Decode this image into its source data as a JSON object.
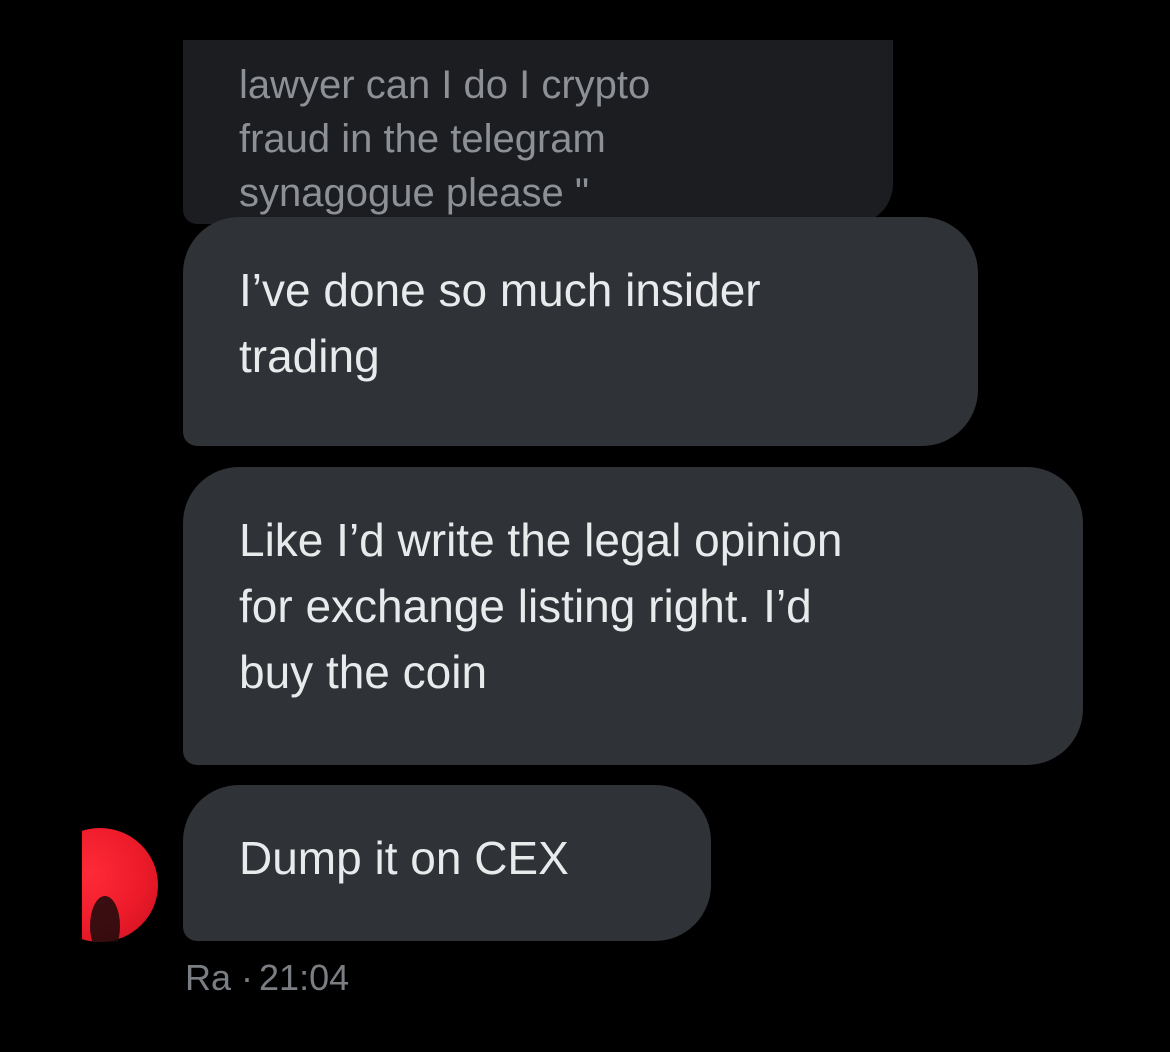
{
  "messages": [
    {
      "text": "lawyer can I do I crypto\nfraud in the telegram\nsynagogue please \"",
      "state": "partially-cropped"
    },
    {
      "text": "I’ve done so much insider\ntrading"
    },
    {
      "text": "Like I’d write the legal opinion\nfor exchange listing right. I’d\nbuy the coin"
    },
    {
      "text": "Dump it on CEX"
    }
  ],
  "meta": {
    "sender": "Ra",
    "separator": "·",
    "time": "21:04"
  },
  "colors": {
    "background": "#000000",
    "bubble": "#2f3236",
    "bubble_text": "#e9eaeb",
    "meta_text": "#7a7e83",
    "avatar": "#ed1b2a"
  },
  "icons": {
    "avatar": "red-circle-avatar"
  }
}
